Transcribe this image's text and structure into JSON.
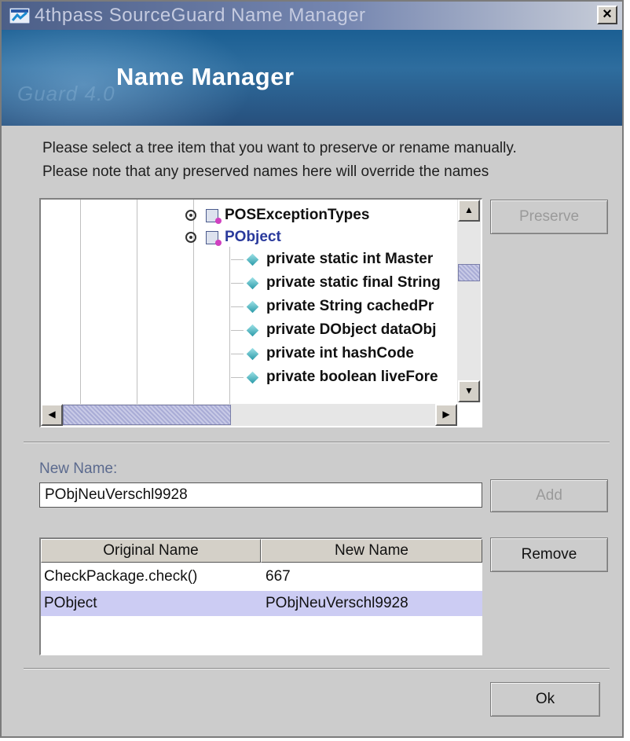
{
  "window": {
    "title": "4thpass SourceGuard Name Manager",
    "close_label": "×"
  },
  "banner": {
    "title": "Name Manager",
    "faded_text": "Guard 4.0"
  },
  "description": {
    "line1": "Please select a tree item that you want to preserve or rename manually.",
    "line2": "Please note that any preserved names here will override the names"
  },
  "tree": {
    "items": [
      {
        "label": "POSExceptionTypes",
        "kind": "class"
      },
      {
        "label": "PObject",
        "kind": "class",
        "selected": true
      },
      {
        "label": "private static int Master",
        "kind": "member"
      },
      {
        "label": "private static final String",
        "kind": "member"
      },
      {
        "label": "private String cachedPr",
        "kind": "member"
      },
      {
        "label": "private DObject dataObj",
        "kind": "member"
      },
      {
        "label": "private int hashCode",
        "kind": "member"
      },
      {
        "label": "private boolean liveFore",
        "kind": "member"
      }
    ],
    "vscroll_position": 0.3,
    "hscroll_position": 0.0
  },
  "buttons": {
    "preserve": "Preserve",
    "add": "Add",
    "remove": "Remove",
    "ok": "Ok"
  },
  "new_name": {
    "label": "New Name:",
    "value": "PObjNeuVerschl9928"
  },
  "table": {
    "headers": [
      "Original Name",
      "New Name"
    ],
    "rows": [
      {
        "original": "CheckPackage.check()",
        "new": "667"
      },
      {
        "original": "PObject",
        "new": "PObjNeuVerschl9928",
        "selected": true
      }
    ]
  },
  "colors": {
    "selection": "#ccccf3",
    "dialog_bg": "#cccccc",
    "banner": "#2e6d9e"
  }
}
